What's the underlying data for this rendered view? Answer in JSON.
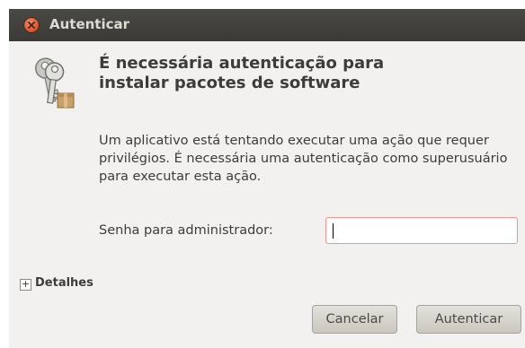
{
  "window": {
    "title": "Autenticar"
  },
  "icons": {
    "close": "close-icon",
    "keys": "keys-icon",
    "expander": "plus-icon"
  },
  "dialog": {
    "heading": "É necessária autenticação para instalar pacotes de software",
    "description": "Um aplicativo está tentando executar uma ação que requer privilégios. É necessária uma autenticação como superusuário para executar esta ação.",
    "password_label": "Senha para administrador:",
    "password_value": "",
    "details_label": "Detalhes",
    "details_expander": "+",
    "cancel_label": "Cancelar",
    "authenticate_label": "Autenticar"
  },
  "colors": {
    "titlebar": "#3c3b37",
    "window_bg": "#f2f1f0",
    "close_button": "#e2572e",
    "input_border_focus": "#e89a92"
  }
}
